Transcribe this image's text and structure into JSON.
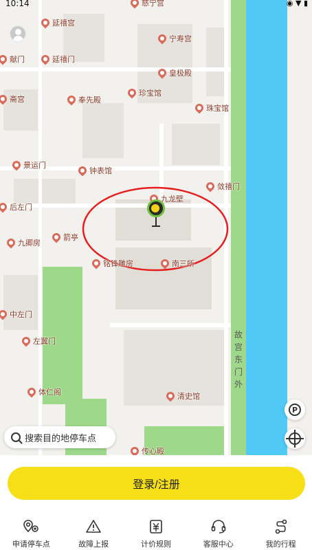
{
  "status_bar": {
    "time": "10:14",
    "icons": "◉ ▼ ▮"
  },
  "map": {
    "pois": [
      {
        "label": "慈宁宫"
      },
      {
        "label": "延禧宫"
      },
      {
        "label": "宁寿宫"
      },
      {
        "label": "献门"
      },
      {
        "label": "延禧门"
      },
      {
        "label": "皇极殿"
      },
      {
        "label": "斋宫"
      },
      {
        "label": "奉先殿"
      },
      {
        "label": "珍宝馆"
      },
      {
        "label": "珠宝馆"
      },
      {
        "label": "景运门"
      },
      {
        "label": "钟表馆"
      },
      {
        "label": "九龙壁"
      },
      {
        "label": "敛禧门"
      },
      {
        "label": "后左门"
      },
      {
        "label": "九卿房"
      },
      {
        "label": "箭亭"
      },
      {
        "label": "铭锋雕房"
      },
      {
        "label": "南三所"
      },
      {
        "label": "中左门"
      },
      {
        "label": "左翼门"
      },
      {
        "label": "体仁阁"
      },
      {
        "label": "清史馆"
      },
      {
        "label": "传心殿"
      }
    ],
    "street_label": [
      "故",
      "宫",
      "东",
      "门",
      "外"
    ],
    "colors": {
      "river": "#51c9f7",
      "green": "#9ed88a",
      "background": "#f3f1ed",
      "circle": "#e61e1e"
    }
  },
  "search": {
    "placeholder": "搜索目的地停车点"
  },
  "login_button": "登录/注册",
  "nav": [
    {
      "label": "申请停车点",
      "icon": "location-pin-icon"
    },
    {
      "label": "故障上报",
      "icon": "warning-icon"
    },
    {
      "label": "计价规则",
      "icon": "price-icon"
    },
    {
      "label": "客服中心",
      "icon": "headset-icon"
    },
    {
      "label": "我的行程",
      "icon": "route-icon"
    }
  ]
}
